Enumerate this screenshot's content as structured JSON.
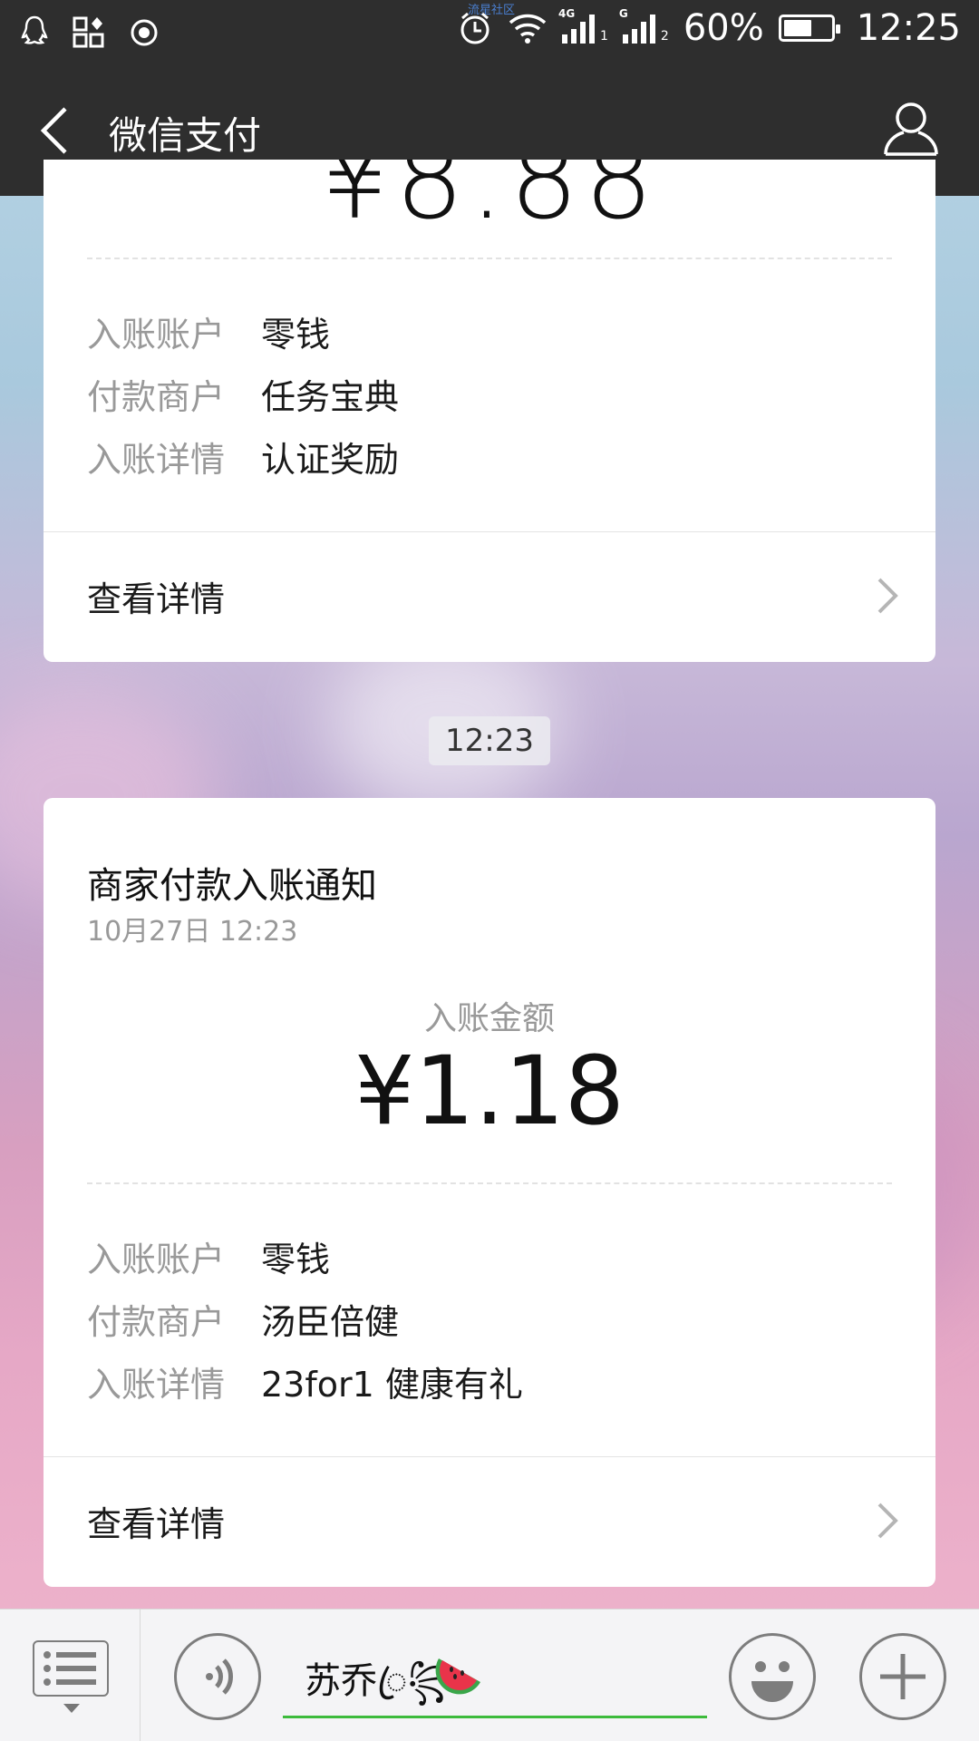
{
  "status_bar": {
    "watermark": "流星社区",
    "network_1": "4G",
    "network_2": "G",
    "sim_1": "1",
    "sim_2": "2",
    "battery_text": "60%",
    "battery_level": 0.6,
    "time": "12:25"
  },
  "nav": {
    "title": "微信支付"
  },
  "card_top": {
    "rows": [
      {
        "key": "入账账户",
        "value": "零钱"
      },
      {
        "key": "付款商户",
        "value": "任务宝典"
      },
      {
        "key": "入账详情",
        "value": "认证奖励"
      }
    ],
    "detail_link": "查看详情"
  },
  "time_divider": "12:23",
  "card_main": {
    "title": "商家付款入账通知",
    "date": "10月27日  12:23",
    "amount_label": "入账金额",
    "amount": "¥1.18",
    "rows": [
      {
        "key": "入账账户",
        "value": "零钱"
      },
      {
        "key": "付款商户",
        "value": "汤臣倍健"
      },
      {
        "key": "入账详情",
        "value": "23for1  健康有礼"
      }
    ],
    "detail_link": "查看详情"
  },
  "input_bar": {
    "text": "苏乔ꦿ꧂"
  },
  "colors": {
    "bar_bg": "#2e2e2e",
    "accent_green": "#3dbb3c",
    "muted_text": "#999999"
  }
}
